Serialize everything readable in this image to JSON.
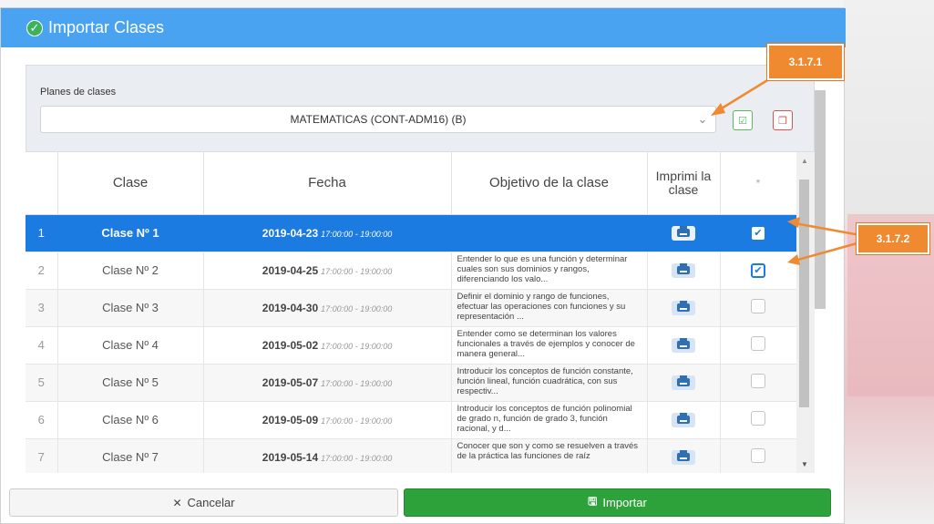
{
  "dialog": {
    "title": "Importar Clases",
    "plan_label": "Planes de clases",
    "plan_selected": "MATEMATICAS (CONT-ADM16) (B)"
  },
  "table": {
    "headers": {
      "clase": "Clase",
      "fecha": "Fecha",
      "objetivo": "Objetivo de la clase",
      "imprimir": "Imprimi la clase",
      "star": "*"
    },
    "rows": [
      {
        "num": "1",
        "clase": "Clase Nº 1",
        "date": "2019-04-23",
        "time": "17:00:00 - 19:00:00",
        "objective": "",
        "checked": true,
        "selected": true
      },
      {
        "num": "2",
        "clase": "Clase Nº 2",
        "date": "2019-04-25",
        "time": "17:00:00 - 19:00:00",
        "objective": "Entender lo que es una función y determinar cuales son sus dominios y rangos, diferenciando los valo...",
        "checked": true,
        "selected": false
      },
      {
        "num": "3",
        "clase": "Clase Nº 3",
        "date": "2019-04-30",
        "time": "17:00:00 - 19:00:00",
        "objective": "Definir el dominio y rango de funciones, efectuar las operaciones con funciones y su representación ...",
        "checked": false,
        "selected": false
      },
      {
        "num": "4",
        "clase": "Clase Nº 4",
        "date": "2019-05-02",
        "time": "17:00:00 - 19:00:00",
        "objective": "Entender como se determinan los valores funcionales a través de ejemplos y conocer de manera general...",
        "checked": false,
        "selected": false
      },
      {
        "num": "5",
        "clase": "Clase Nº 5",
        "date": "2019-05-07",
        "time": "17:00:00 - 19:00:00",
        "objective": "Introducir los conceptos de función constante, función lineal, función cuadrática, con sus respectiv...",
        "checked": false,
        "selected": false
      },
      {
        "num": "6",
        "clase": "Clase Nº 6",
        "date": "2019-05-09",
        "time": "17:00:00 - 19:00:00",
        "objective": "Introducir los conceptos de función polinomial de grado n, función de grado 3, función racional, y d...",
        "checked": false,
        "selected": false
      },
      {
        "num": "7",
        "clase": "Clase Nº 7",
        "date": "2019-05-14",
        "time": "17:00:00 - 19:00:00",
        "objective": "Conocer que son y como se resuelven a través de la práctica las funciones de raíz",
        "checked": false,
        "selected": false
      }
    ]
  },
  "footer": {
    "cancel_label": "Cancelar",
    "import_label": "Importar"
  },
  "annotations": {
    "callout_1": "3.1.7.1",
    "callout_2": "3.1.7.2"
  },
  "icons": {
    "header": "check-circle-icon",
    "chevron": "chevron-down-icon",
    "check_all": "check-square-icon",
    "uncheck_all": "uncheck-square-icon",
    "print": "printer-icon",
    "cancel": "close-icon",
    "import": "save-icon"
  },
  "colors": {
    "header": "#4aa3f0",
    "selected_row": "#1c7be0",
    "import_button": "#2ea23a",
    "callout": "#f08a30"
  }
}
